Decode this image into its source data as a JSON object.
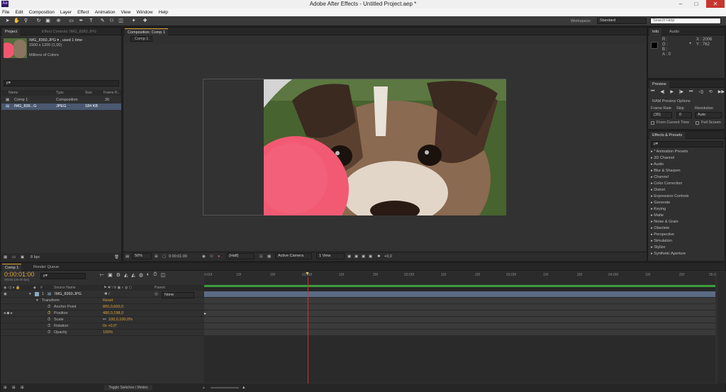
{
  "app": {
    "title": "Adobe After Effects - Untitled Project.aep *",
    "logo": "Ae"
  },
  "window_controls": {
    "minimize": "–",
    "maximize": "□",
    "close": "✕"
  },
  "menu": [
    "File",
    "Edit",
    "Composition",
    "Layer",
    "Effect",
    "Animation",
    "View",
    "Window",
    "Help"
  ],
  "toolbar": {
    "workspace_label": "Workspace:",
    "workspace_value": "Standard",
    "search_placeholder": "Search Help"
  },
  "project": {
    "tab_project": "Project",
    "tab_effect_controls": "Effect Controls: IMG_8360.JPG",
    "selected_name": "IMG_8360.JPG ▾ , used 1 time",
    "selected_dims": "1500 x 1200 (1,00)",
    "selected_colors": "Millions of Colors",
    "search_value": "ρ▾",
    "columns": {
      "name": "Name",
      "type": "Type",
      "size": "Size",
      "frame_rate": "Frame R..."
    },
    "items": [
      {
        "name": "Comp 1",
        "type": "Composition",
        "size": "",
        "frame_rate": "30"
      },
      {
        "name": "IMG_836...G",
        "type": "JPEG",
        "size": "184 KB",
        "frame_rate": ""
      }
    ],
    "bpc": "8 bpc"
  },
  "composition": {
    "tab": "Composition: Comp 1",
    "breadcrumb": "Comp 1",
    "zoom": "50%",
    "timecode": "0:00:01:00",
    "resolution": "(Half)",
    "camera": "Active Camera",
    "view": "1 View",
    "exposure": "+0,0"
  },
  "info": {
    "tab_info": "Info",
    "tab_audio": "Audio",
    "r": "R :",
    "g": "G :",
    "b": "B :",
    "a": "A : 0",
    "x": "X : 2006",
    "y": "Y : 762"
  },
  "preview": {
    "tab": "Preview",
    "ram_options": "RAM Preview Options",
    "frame_rate_label": "Frame Rate",
    "skip_label": "Skip",
    "resolution_label": "Resolution",
    "frame_rate_value": "(30)",
    "skip_value": "0",
    "resolution_value": "Auto",
    "from_current": "From Current Time",
    "full_screen": "Full Screen"
  },
  "effects": {
    "tab": "Effects & Presets",
    "search_value": "ρ▾",
    "items": [
      "* Animation Presets",
      "3D Channel",
      "Audio",
      "Blur & Sharpen",
      "Channel",
      "Color Correction",
      "Distort",
      "Expression Controls",
      "Generate",
      "Keying",
      "Matte",
      "Noise & Grain",
      "Obsolete",
      "Perspective",
      "Simulation",
      "Stylize",
      "Synthetic Aperture"
    ]
  },
  "timeline": {
    "tab_comp": "Comp 1",
    "tab_render": "Render Queue",
    "timecode": "0:00:01:00",
    "frame_info": "00030 (30.00 fps)",
    "search_value": "ρ▾",
    "col_source": "Source Name",
    "col_parent": "Parent",
    "layer": {
      "index": "1",
      "name": "IMG_8360.JPG",
      "parent": "None"
    },
    "transform": {
      "label": "Transform",
      "reset": "Reset"
    },
    "properties": [
      {
        "name": "Anchor Point",
        "value": "800,0,600,0"
      },
      {
        "name": "Position",
        "value": "480,0,198,0"
      },
      {
        "name": "Scale",
        "value": "100,0,100,0%"
      },
      {
        "name": "Rotation",
        "value": "0x +0,0°"
      },
      {
        "name": "Opacity",
        "value": "100%"
      }
    ],
    "ruler": [
      "0:00f",
      "10f",
      "20f",
      "01:00f",
      "10f",
      "20f",
      "02:00f",
      "10f",
      "20f",
      "03:00f",
      "10f",
      "20f",
      "04:00f",
      "10f",
      "20f",
      "05:0"
    ],
    "toggle_label": "Toggle Switches / Modes"
  },
  "colors": {
    "accent": "#d8a335",
    "work_area": "#3b9c3b",
    "playhead": "#c33"
  }
}
